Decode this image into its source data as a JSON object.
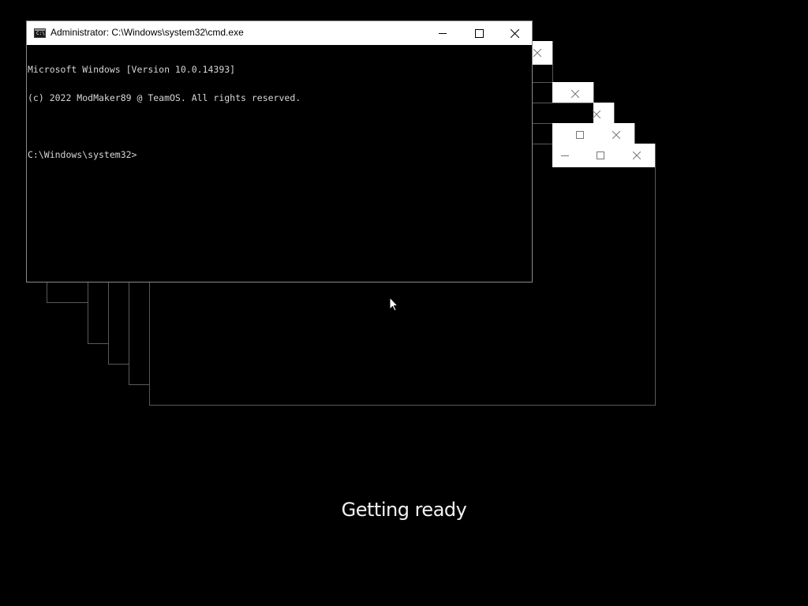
{
  "window": {
    "title": "Administrator: C:\\Windows\\system32\\cmd.exe",
    "icon": "cmd-icon",
    "icon_glyph": "C:\\"
  },
  "console": {
    "lines": [
      "Microsoft Windows [Version 10.0.14393]",
      "(c) 2022 ModMaker89 @ TeamOS. All rights reserved.",
      "",
      "C:\\Windows\\system32>"
    ]
  },
  "status": {
    "text": "Getting ready"
  },
  "icons": {
    "minimize": "minimize-icon",
    "maximize": "maximize-icon",
    "close": "close-icon"
  }
}
